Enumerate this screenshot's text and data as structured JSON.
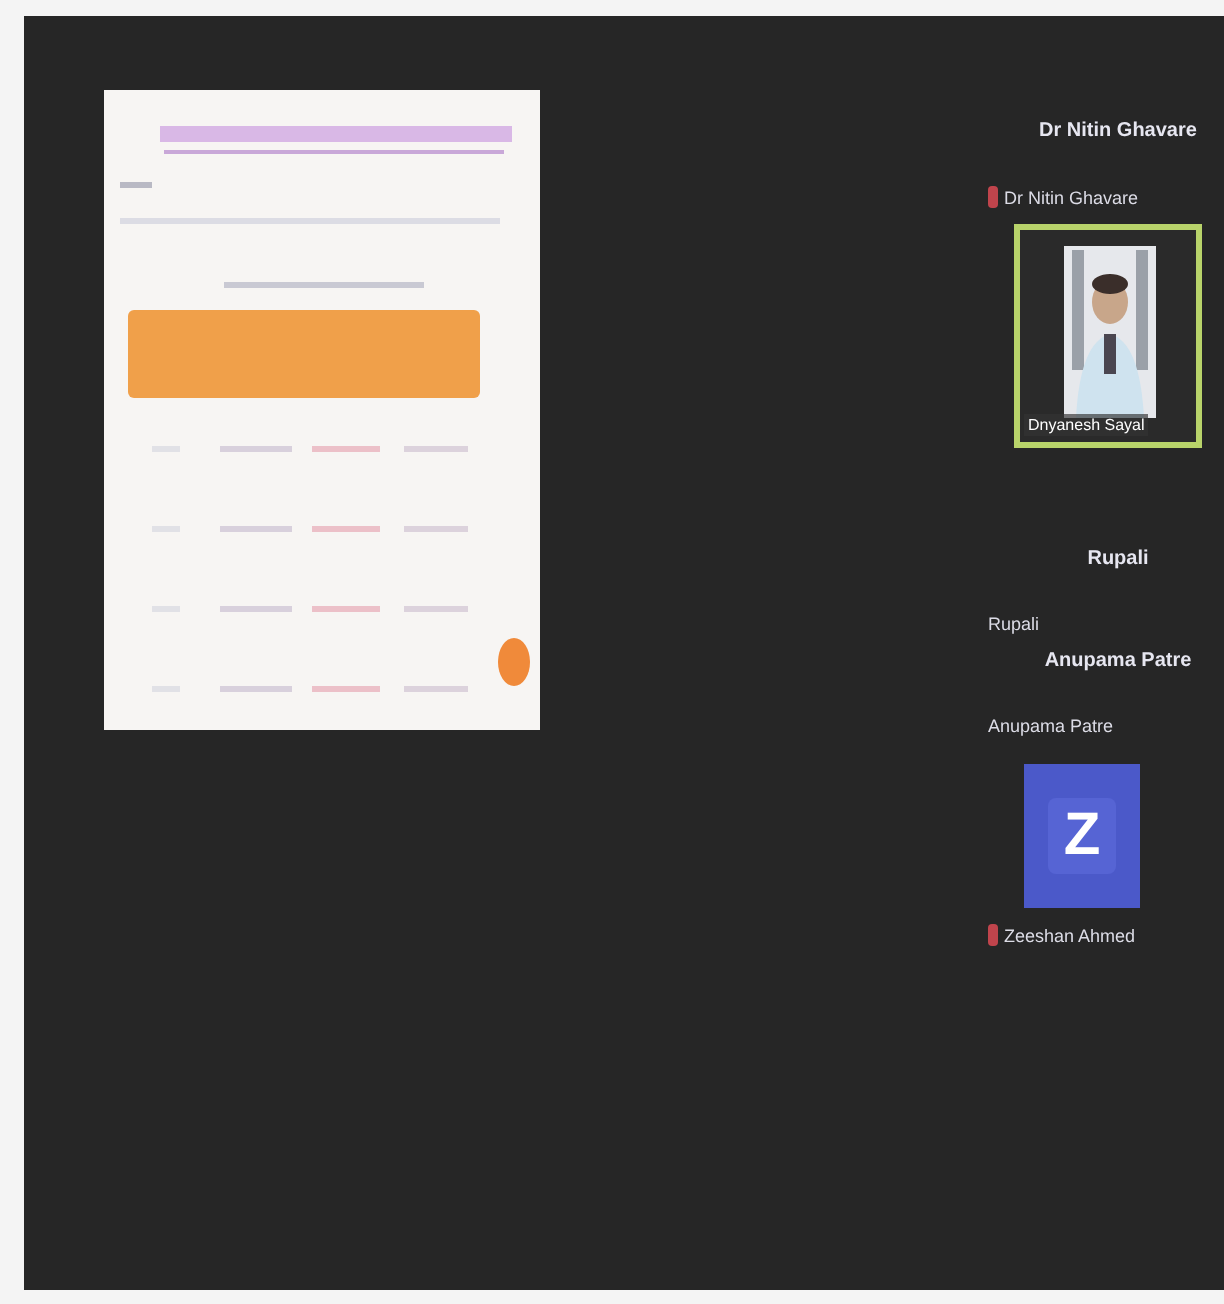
{
  "shared_screen": {
    "kind": "slide"
  },
  "participants": [
    {
      "kind": "heading",
      "text": "Dr Nitin Ghavare"
    },
    {
      "kind": "name",
      "text": "Dr Nitin Ghavare",
      "muted": true
    },
    {
      "kind": "video",
      "label": "Dnyanesh Sayal",
      "selected": true
    },
    {
      "kind": "heading",
      "text": "Rupali"
    },
    {
      "kind": "name",
      "text": "Rupali",
      "muted": false
    },
    {
      "kind": "heading",
      "text": "Anupama Patre"
    },
    {
      "kind": "name",
      "text": "Anupama Patre",
      "muted": false
    },
    {
      "kind": "avatar",
      "letter": "Z"
    },
    {
      "kind": "name",
      "text": "Zeeshan Ahmed",
      "muted": true
    }
  ]
}
